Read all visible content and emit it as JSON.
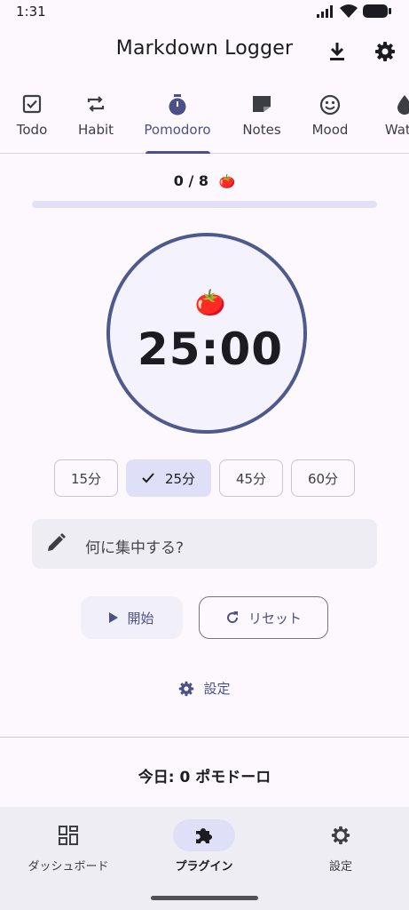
{
  "status_bar": {
    "time": "1:31"
  },
  "app_bar": {
    "title": "Markdown Logger",
    "actions": [
      "download-icon",
      "gear-icon"
    ]
  },
  "tabs": [
    {
      "label": "Todo",
      "icon": "checkbox-icon",
      "active": false
    },
    {
      "label": "Habit",
      "icon": "repeat-icon",
      "active": false
    },
    {
      "label": "Pomodoro",
      "icon": "stopwatch-icon",
      "active": true
    },
    {
      "label": "Notes",
      "icon": "note-icon",
      "active": false
    },
    {
      "label": "Mood",
      "icon": "smiley-icon",
      "active": false
    },
    {
      "label": "Water",
      "icon": "water-drop-icon",
      "active": false
    }
  ],
  "pomodoro": {
    "counter": "0 / 8",
    "counter_icon": "🍅",
    "progress_fraction": 0,
    "timer_icon": "🍅",
    "timer": "25:00",
    "durations": [
      {
        "label": "15分",
        "selected": false
      },
      {
        "label": "25分",
        "selected": true
      },
      {
        "label": "45分",
        "selected": false
      },
      {
        "label": "60分",
        "selected": false
      }
    ],
    "focus_placeholder": "何に集中する?",
    "start_label": "開始",
    "reset_label": "リセット",
    "settings_label": "設定",
    "today_summary": "今日: 0 ポモドーロ"
  },
  "bottom_nav": [
    {
      "label": "ダッシュボード",
      "icon": "dashboard-icon",
      "active": false
    },
    {
      "label": "プラグイン",
      "icon": "puzzle-icon",
      "active": true
    },
    {
      "label": "設定",
      "icon": "gear-icon",
      "active": false
    }
  ],
  "colors": {
    "accent": "#4a5187",
    "background": "#fcf8fe",
    "chip_selected": "#dfe0f7"
  }
}
